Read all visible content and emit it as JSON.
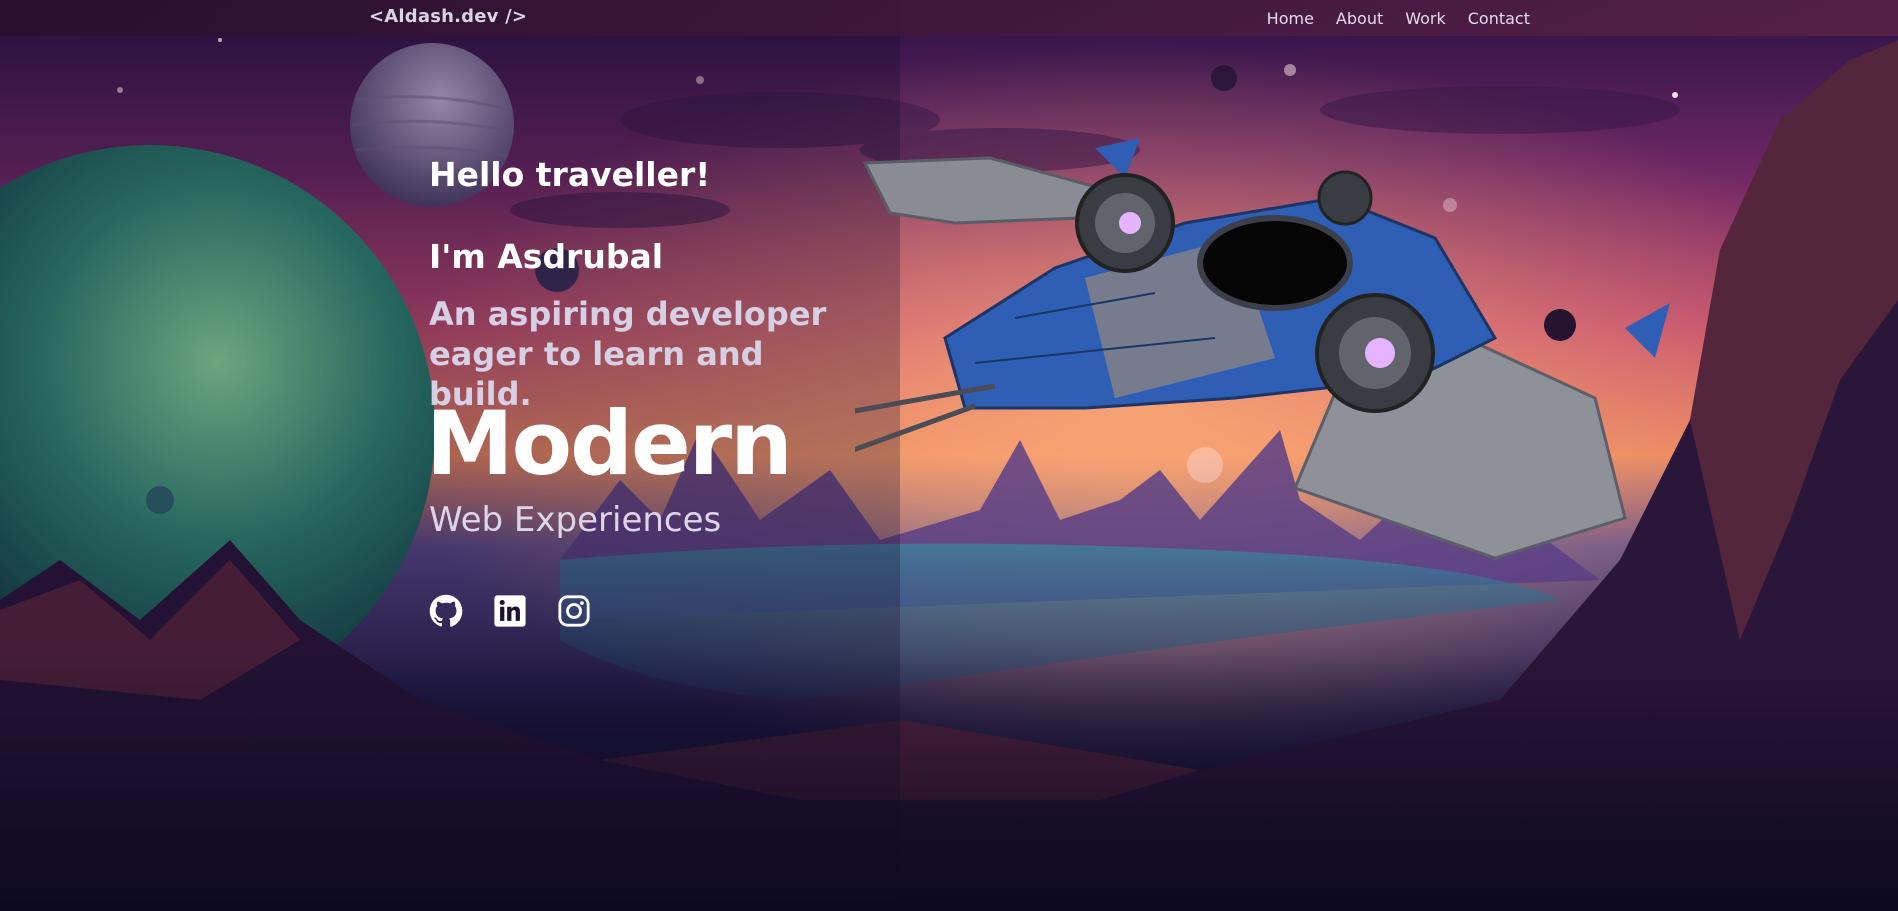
{
  "navbar": {
    "logo": "<Aldash.dev />",
    "links": [
      {
        "label": "Home"
      },
      {
        "label": "About"
      },
      {
        "label": "Work"
      },
      {
        "label": "Contact"
      }
    ]
  },
  "hero": {
    "greeting": "Hello traveller!",
    "intro": "I'm Asdrubal",
    "tagline_line1": "An aspiring developer",
    "tagline_line2": "eager to learn and build.",
    "headline": "Modern",
    "subheadline": "Web Experiences"
  },
  "socials": [
    {
      "icon": "github-icon"
    },
    {
      "icon": "linkedin-icon"
    },
    {
      "icon": "instagram-icon"
    }
  ],
  "colors": {
    "text_primary": "#ffffff",
    "text_muted": "#d7cfe4",
    "sky_orange": "#f08a5d",
    "sky_magenta": "#b83b7a",
    "ship_blue": "#2f5fb5",
    "planet_green": "#3aa57a"
  }
}
